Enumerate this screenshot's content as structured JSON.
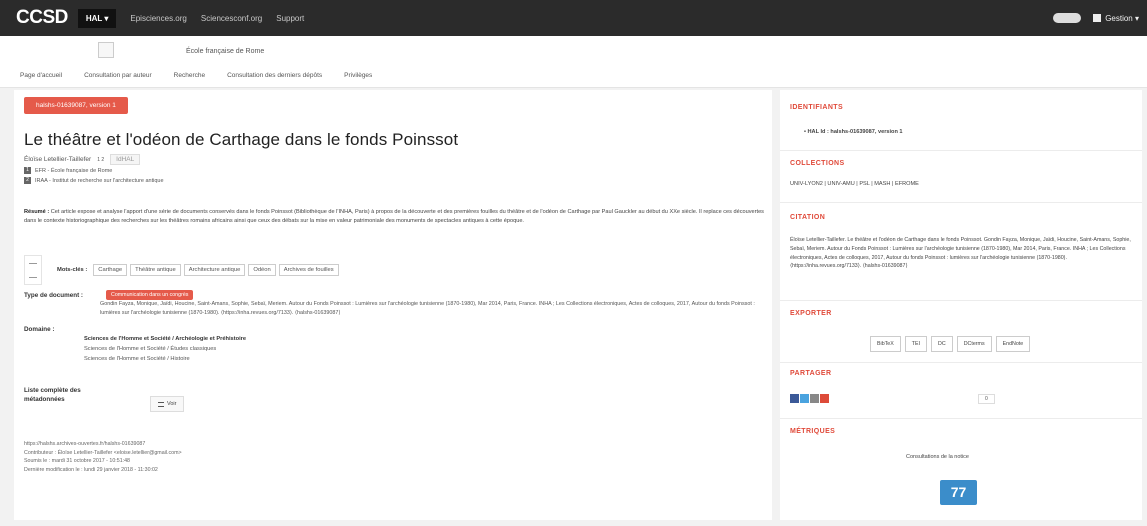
{
  "topbar": {
    "logo": "CCSD",
    "nav": [
      "HAL ▾",
      "Episciences.org",
      "Sciencesconf.org",
      "Support"
    ],
    "user": "Gestion ▾"
  },
  "header": {
    "portal_name": "École française de Rome",
    "menu": [
      "Page d'accueil",
      "Consultation par auteur",
      "Recherche",
      "Consultation des derniers dépôts",
      "Privilèges"
    ]
  },
  "article": {
    "version": "halshs-01639087, version 1",
    "title": "Le théâtre et l'odéon de Carthage dans le fonds Poinssot",
    "authors": "Éloïse Letellier-Taillefer",
    "author_sup": "1 2",
    "idhal_button": "IdHAL",
    "affiliations": [
      {
        "num": "1",
        "text": "EFR - École française de Rome"
      },
      {
        "num": "2",
        "text": "IRAA - Institut de recherche sur l'architecture antique"
      }
    ],
    "abstract_label": "Résumé :",
    "abstract": "Cet article expose et analyse l'apport d'une série de documents conservés dans le fonds Poinssot (Bibliothèque de l'INHA, Paris) à propos de la découverte et des premières fouilles du théâtre et de l'odéon de Carthage par Paul Gauckler au début du XXe siècle. Il replace ces découvertes dans le contexte historiographique des recherches sur les théâtres romains africains ainsi que ceux des débats sur la mise en valeur patrimoniale des monuments de spectacles antiques à cette époque.",
    "keywords_label": "Mots-clés :",
    "keywords": [
      "Carthage",
      "Théâtre antique",
      "Architecture antique",
      "Odéon",
      "Archives de fouilles"
    ],
    "doctype_label": "Type de document :",
    "doctype": "Communication dans un congrès",
    "doc_ref": "Gondin Fayza, Monique, Jaïdi, Houcine, Saint-Amans, Sophie, Sebaï, Meriem. Autour du Fonds Poinssot : Lumières sur l'archéologie tunisienne (1870-1980), Mar 2014, Paris, France. INHA ; Les Collections électroniques, Actes de colloques, 2017, Autour du fonds Poinssot : lumières sur l'archéologie tunisienne (1870-1980). ⟨https://inha.revues.org/7133⟩. ⟨halshs-01639087⟩",
    "domain_label": "Domaine :",
    "domains": [
      "Sciences de l'Homme et Société / Archéologie et Préhistoire",
      "Sciences de l'Homme et Société / Études classiques",
      "Sciences de l'Homme et Société / Histoire"
    ],
    "metadata_label": "Liste complète des métadonnées",
    "voir_button": "Voir",
    "footer": [
      "https://halshs.archives-ouvertes.fr/halshs-01639087",
      "Contributeur : Éloïse Letellier-Taillefer <eloise.letellier@gmail.com>",
      "Soumis le : mardi 31 octobre 2017 - 10:51:48",
      "Dernière modification le : lundi 29 janvier 2018 - 11:30:02"
    ]
  },
  "sidebar": {
    "identifiants_title": "IDENTIFIANTS",
    "identifiant": "• HAL Id : halshs-01639087, version 1",
    "collections_title": "COLLECTIONS",
    "collections": "UNIV-LYON2 | UNIV-AMU | PSL | MASH | EFROME",
    "citation_title": "CITATION",
    "citation": "Éloïse Letellier-Taillefer. Le théâtre et l'odéon de Carthage dans le fonds Poinssot. Gondin Fayza, Monique, Jaïdi, Houcine, Saint-Amans, Sophie, Sebaï, Meriem. Autour du Fonds Poinssot : Lumières sur l'archéologie tunisienne (1870-1980), Mar 2014, Paris, France. INHA ; Les Collections électroniques, Actes de colloques, 2017, Autour du fonds Poinssot : lumières sur l'archéologie tunisienne (1870-1980). ⟨https://inha.revues.org/7133⟩. ⟨halshs-01639087⟩",
    "export_title": "EXPORTER",
    "export_formats": [
      "BibTeX",
      "TEI",
      "DC",
      "DCterms",
      "EndNote"
    ],
    "share_title": "PARTAGER",
    "share_count": "0",
    "metrics_title": "MÉTRIQUES",
    "metrics_caption": "Consultations de la notice",
    "metrics_value": "77"
  },
  "colors": {
    "accent_red": "#e55a4a",
    "metric_blue": "#3b8dca",
    "topbar": "#2b2b2b"
  }
}
